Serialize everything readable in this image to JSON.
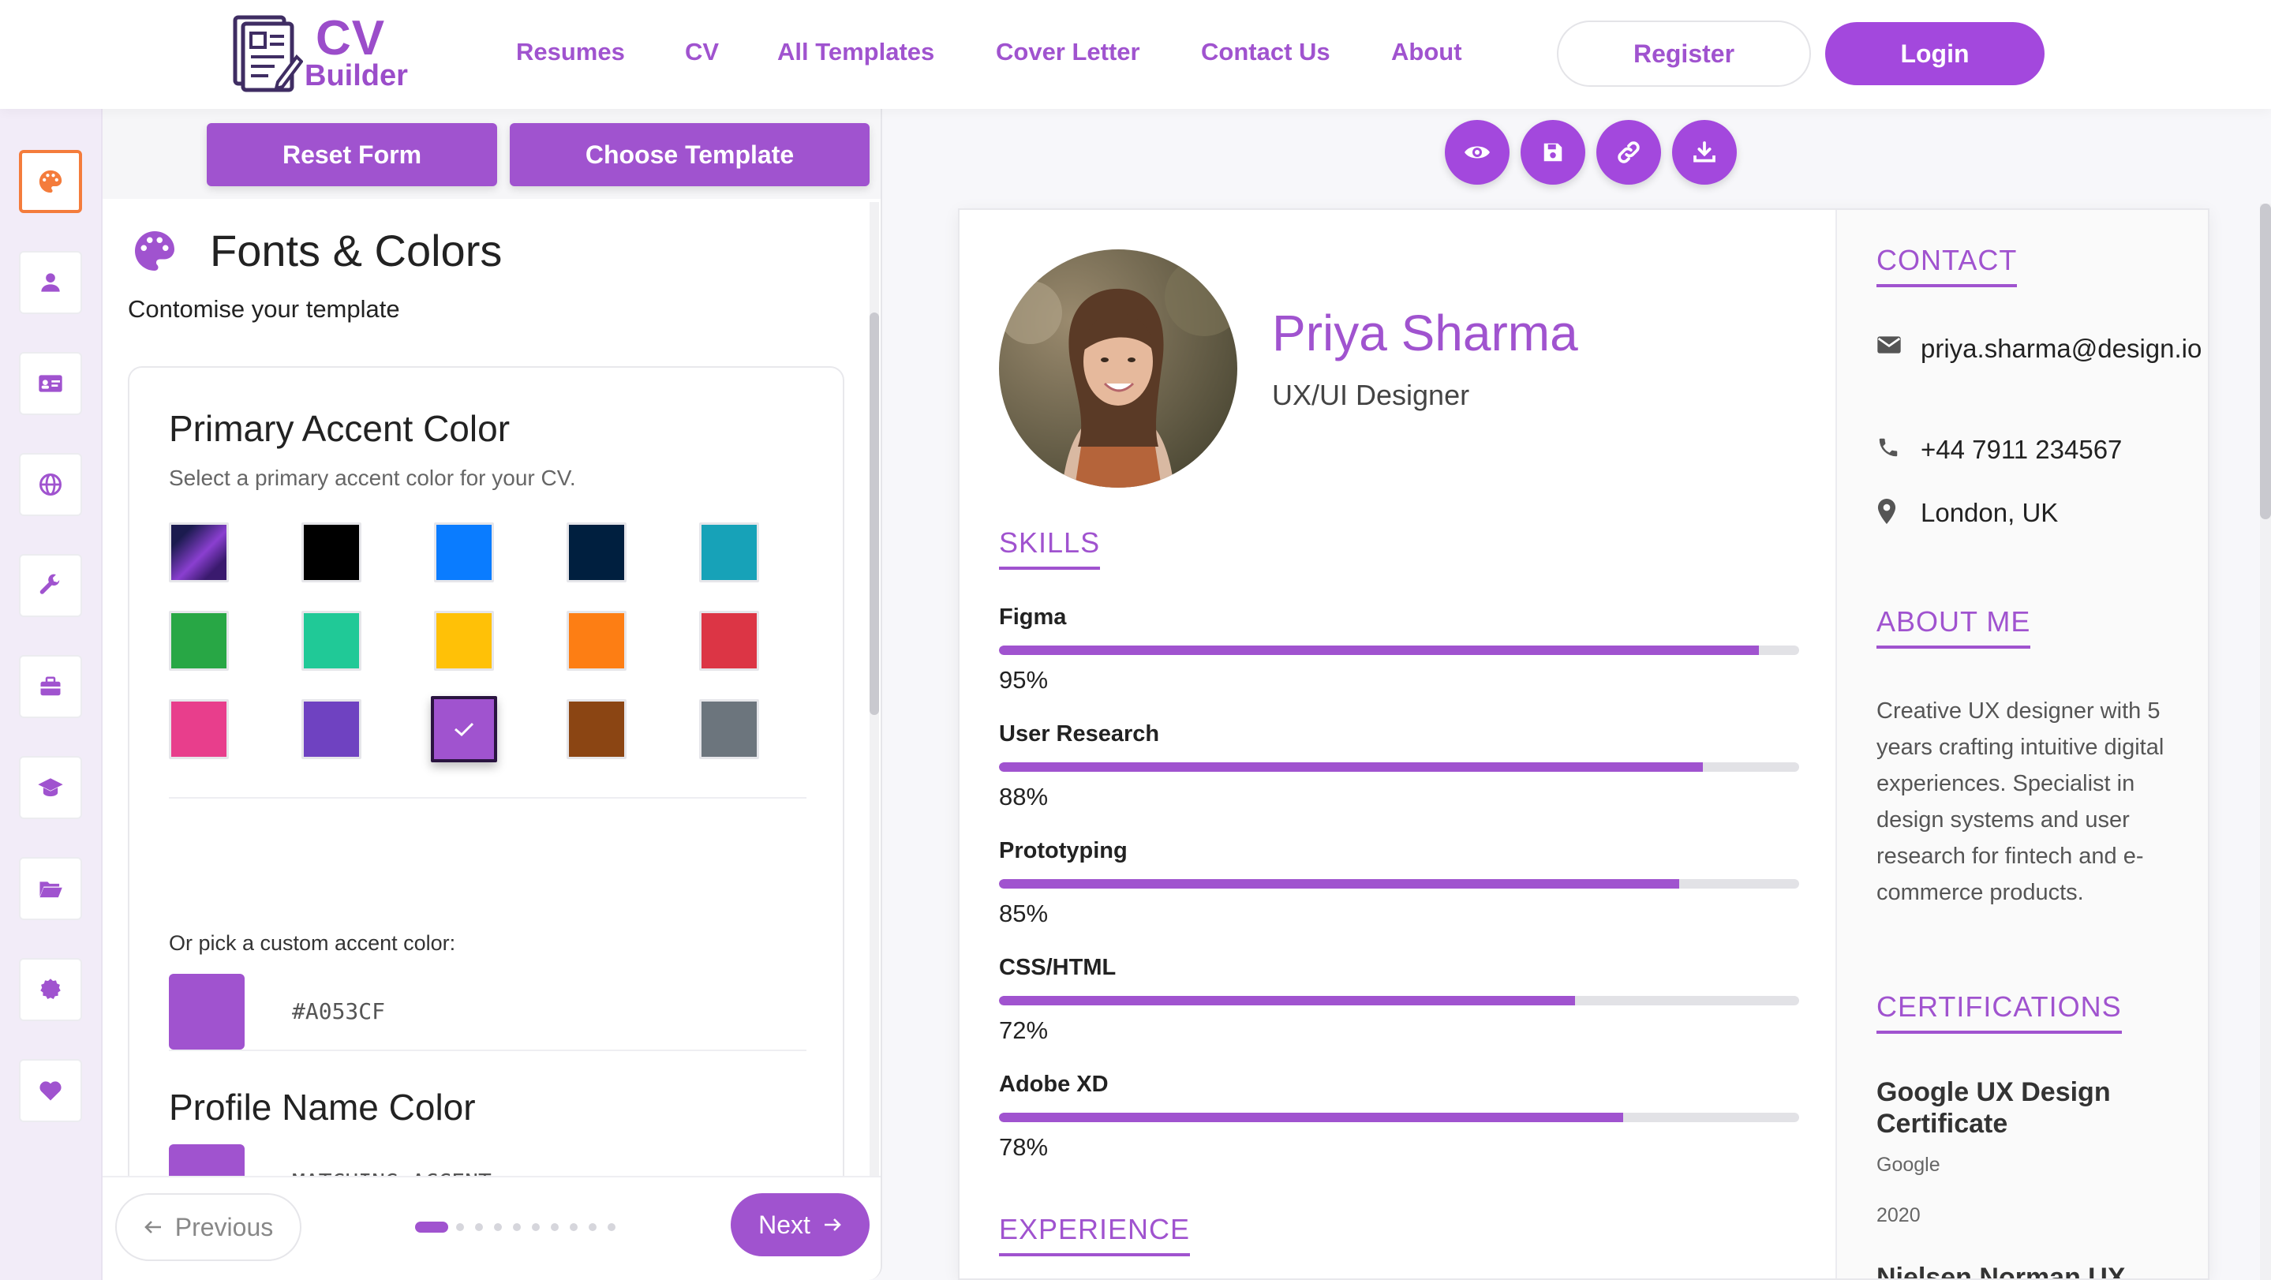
{
  "brand": {
    "line1": "CV",
    "line2": "Builder"
  },
  "nav": [
    "Resumes",
    "CV",
    "All Templates",
    "Cover Letter",
    "Contact Us",
    "About"
  ],
  "auth": {
    "register": "Register",
    "login": "Login"
  },
  "rail": [
    "palette-icon",
    "user-icon",
    "id-card-icon",
    "globe-icon",
    "wrench-icon",
    "briefcase-icon",
    "graduation-cap-icon",
    "folder-open-icon",
    "certificate-icon",
    "heart-icon"
  ],
  "panel": {
    "reset": "Reset Form",
    "choose": "Choose Template",
    "title": "Fonts & Colors",
    "subtitle": "Contomise your template",
    "accent_title": "Primary Accent Color",
    "accent_sub": "Select a primary accent color for your CV.",
    "swatches": [
      "gradient",
      "#000000",
      "#0a7cff",
      "#001f3f",
      "#17a2b8",
      "#28a745",
      "#20c997",
      "#ffc107",
      "#fd7e14",
      "#dc3545",
      "#e83e8c",
      "#6f42c1",
      "#a053cf",
      "#8b4513",
      "#6c757d"
    ],
    "selected_swatch": "#a053cf",
    "custom_label": "Or pick a custom accent color:",
    "custom_value": "#A053CF",
    "name_color_title": "Profile Name Color",
    "name_color_value": "MATCHING ACCENT"
  },
  "footer": {
    "previous": "Previous",
    "next": "Next",
    "pages": 10,
    "current_page": 1
  },
  "actions": [
    "eye-icon",
    "save-icon",
    "link-icon",
    "download-icon"
  ],
  "cv": {
    "name": "Priya Sharma",
    "role": "UX/UI Designer",
    "skills_heading": "SKILLS",
    "skills": [
      {
        "name": "Figma",
        "pct": 95,
        "label": "95%"
      },
      {
        "name": "User Research",
        "pct": 88,
        "label": "88%"
      },
      {
        "name": "Prototyping",
        "pct": 85,
        "label": "85%"
      },
      {
        "name": "CSS/HTML",
        "pct": 72,
        "label": "72%"
      },
      {
        "name": "Adobe XD",
        "pct": 78,
        "label": "78%"
      }
    ],
    "experience_heading": "EXPERIENCE",
    "contact_heading": "CONTACT",
    "email": "priya.sharma@design.io",
    "phone": "+44 7911 234567",
    "location": "London, UK",
    "about_heading": "ABOUT ME",
    "about": "Creative UX designer with 5 years crafting intuitive digital experiences. Specialist in design systems and user research for fintech and e-commerce products.",
    "cert_heading": "CERTIFICATIONS",
    "cert_title": "Google UX Design Certificate",
    "cert_issuer": "Google",
    "cert_year": "2020",
    "next_cert": "Nielsen Norman UX"
  },
  "colors": {
    "accent": "#a053cf",
    "brand": "#9b4dca",
    "active_rail": "#f47c3c"
  }
}
